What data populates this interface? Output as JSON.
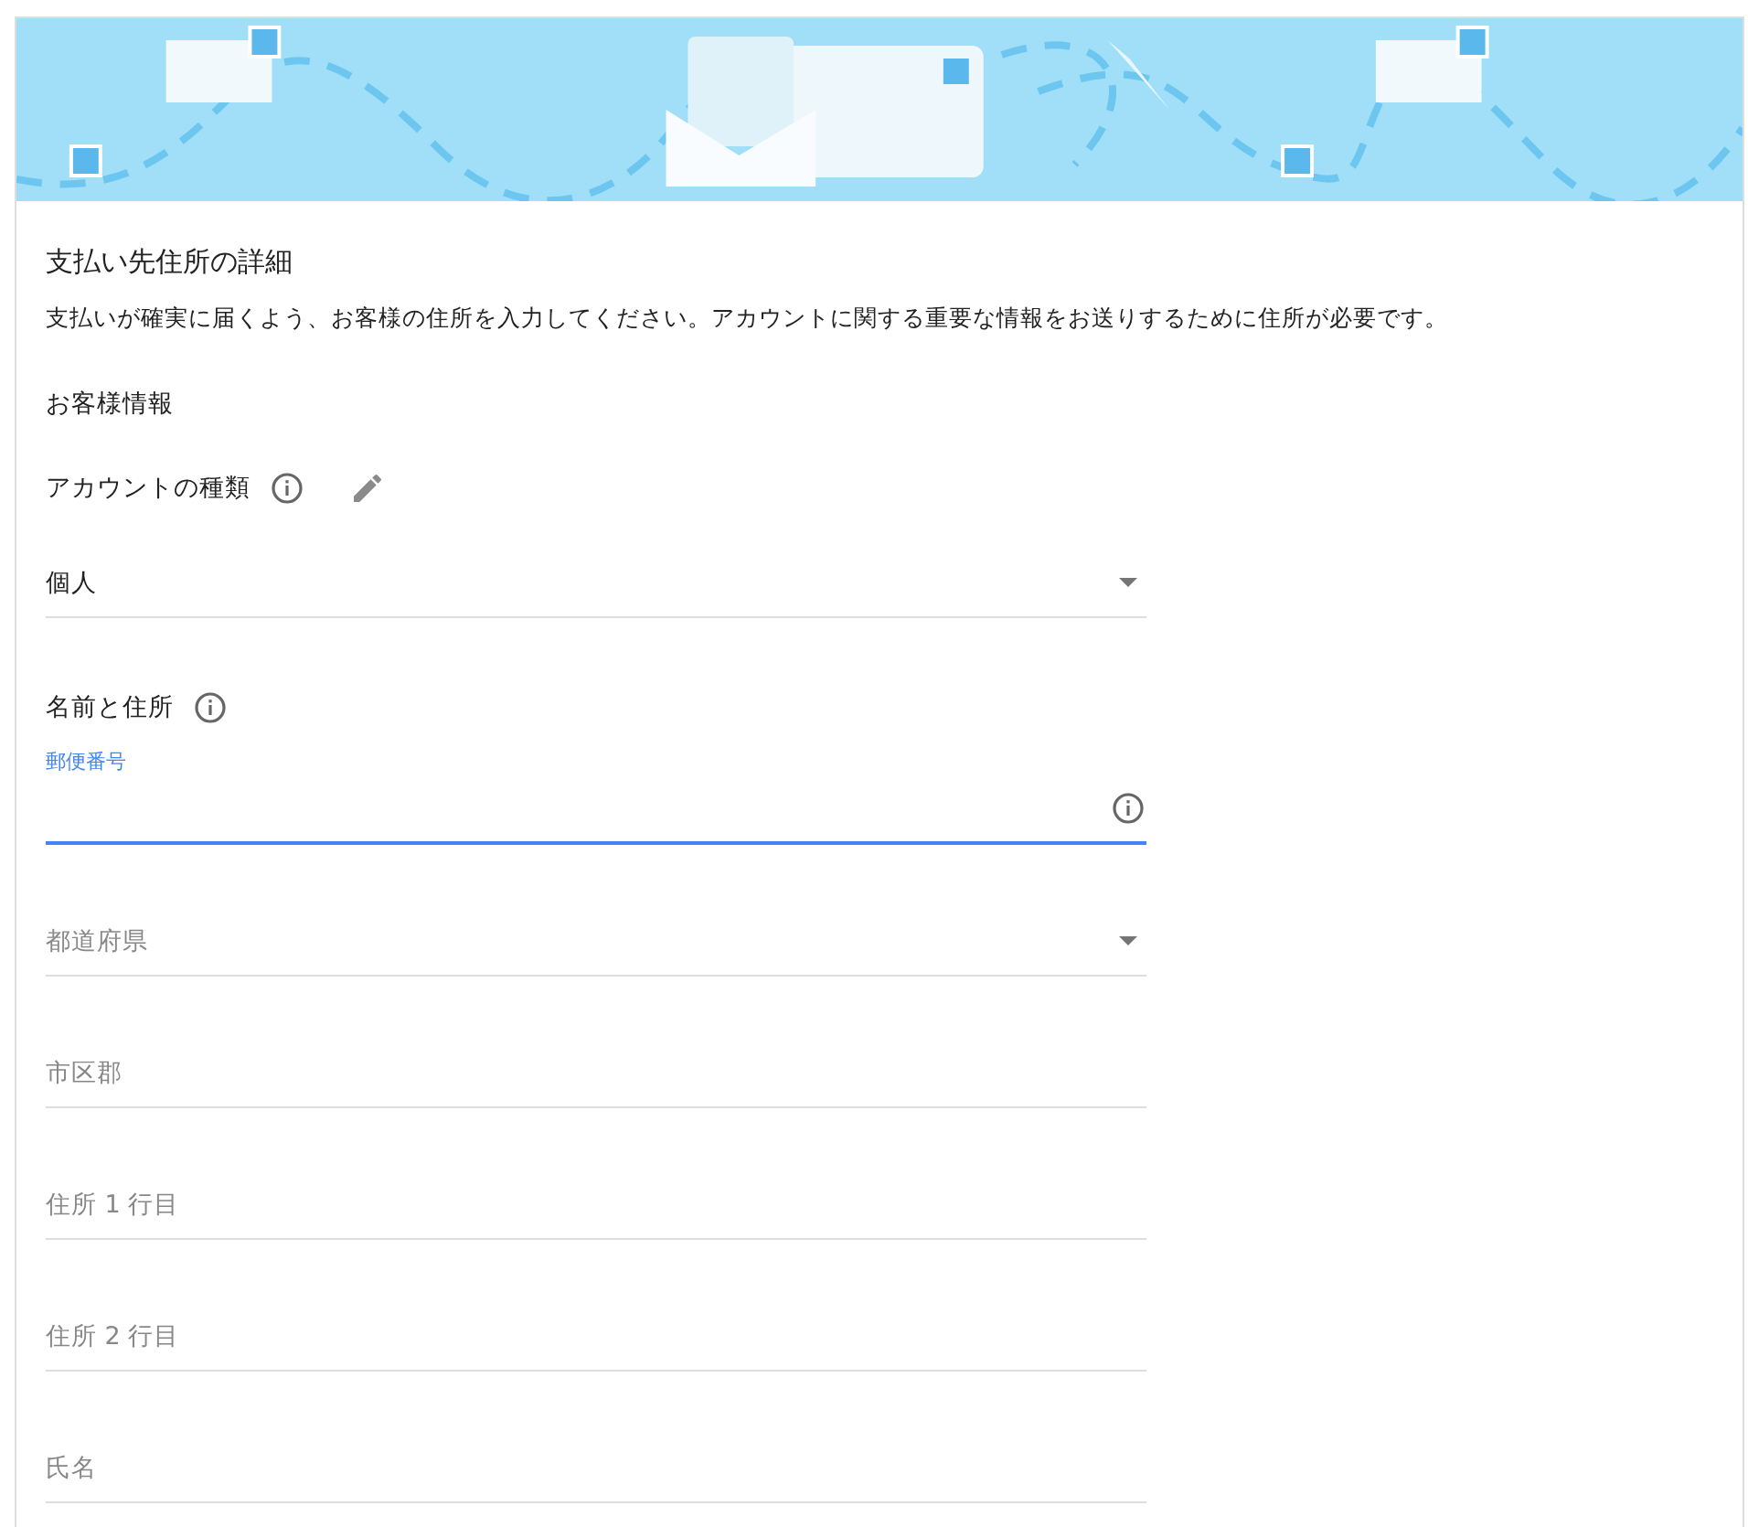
{
  "title": "支払い先住所の詳細",
  "description": "支払いが確実に届くよう、お客様の住所を入力してください。アカウントに関する重要な情報をお送りするために住所が必要です。",
  "section": "お客様情報",
  "account_type": {
    "label": "アカウントの種類",
    "info": true,
    "editable": true,
    "field": {
      "kind": "select",
      "value": "個人",
      "focused": false,
      "info": false
    }
  },
  "name_address": {
    "label": "名前と住所",
    "info": true,
    "fields": [
      {
        "kind": "text",
        "label": "郵便番号",
        "focused": true,
        "info": true
      },
      {
        "kind": "select",
        "placeholder": "都道府県",
        "focused": false,
        "info": false
      },
      {
        "kind": "text",
        "placeholder": "市区郡",
        "focused": false,
        "info": false
      },
      {
        "kind": "text",
        "placeholder": "住所 1 行目",
        "focused": false,
        "info": false
      },
      {
        "kind": "text",
        "placeholder": "住所 2 行目",
        "focused": false,
        "info": false
      },
      {
        "kind": "text",
        "placeholder": "氏名",
        "focused": false,
        "info": false
      }
    ]
  }
}
